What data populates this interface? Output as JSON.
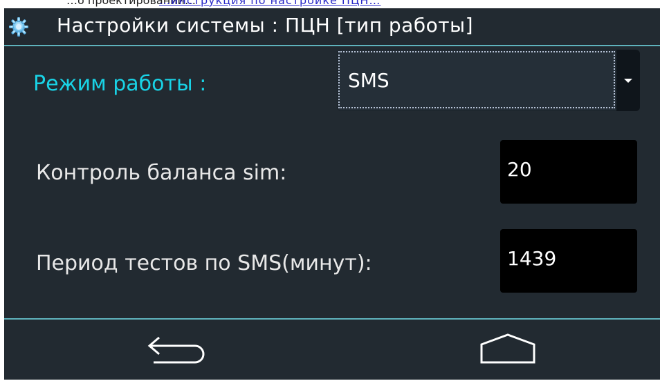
{
  "page_top_strip": {
    "prefix_text": "…о проектировании…",
    "link_text": "…инструкция по настройке ПЦН…"
  },
  "titlebar": {
    "icon": "gear-icon",
    "title": "Настройки системы : ПЦН [тип работы]"
  },
  "mode": {
    "label": "Режим работы :",
    "selected": "SMS"
  },
  "balance": {
    "label": "Контроль баланса sim:",
    "value": "20"
  },
  "test_period": {
    "label": "Период тестов по SMS(минут):",
    "value": "1439"
  },
  "navbar": {
    "back_icon": "back-arrow-icon",
    "home_icon": "home-icon"
  },
  "colors": {
    "background": "#222a31",
    "accent": "#19d3e6",
    "divider": "#5fb3bd",
    "field_bg": "#000000"
  }
}
